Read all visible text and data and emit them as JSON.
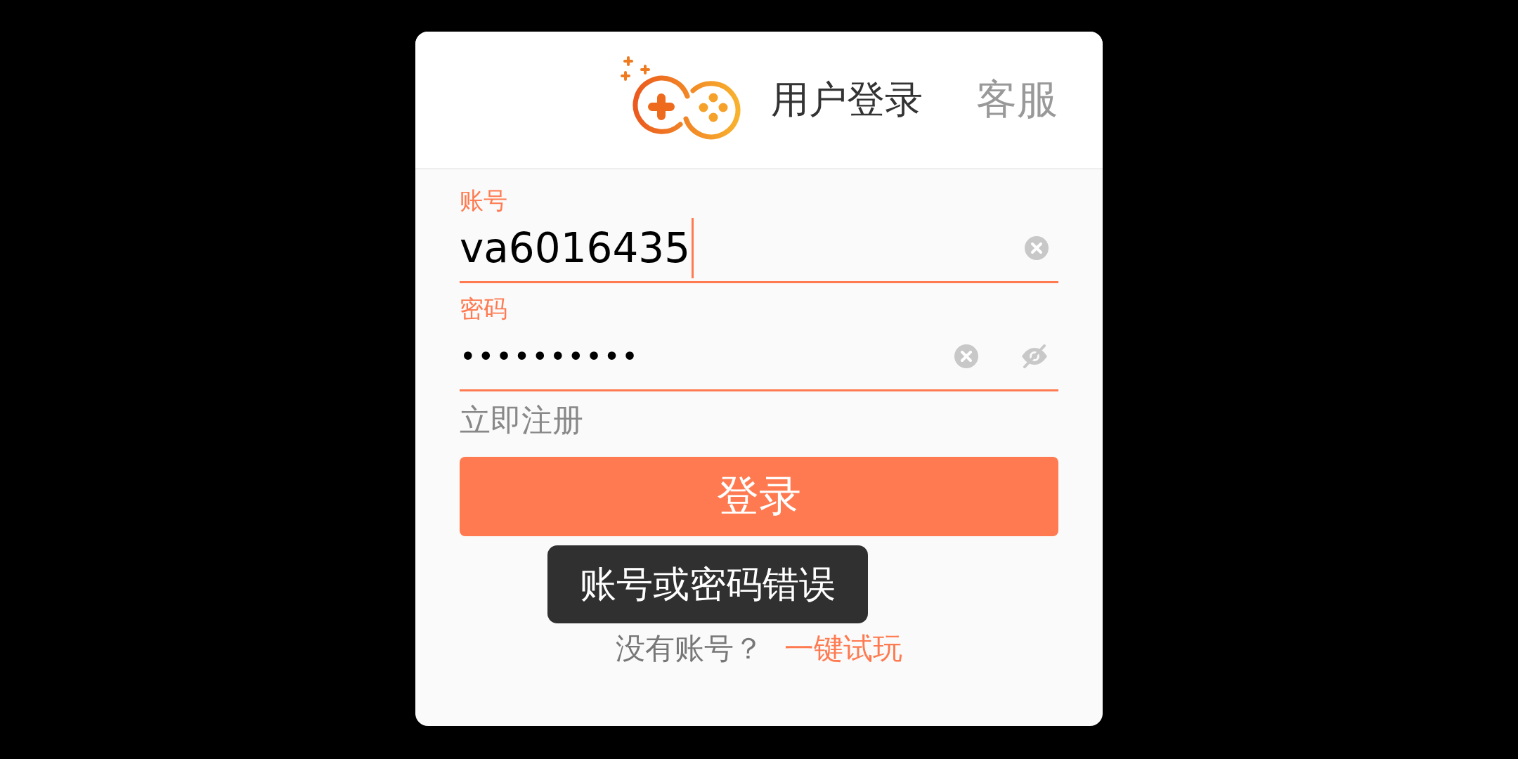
{
  "header": {
    "title": "用户登录",
    "service_link": "客服"
  },
  "account": {
    "label": "账号",
    "value": "va6016435",
    "focused": true
  },
  "password": {
    "label": "密码",
    "value": "••••••••••",
    "masked": true
  },
  "register_link": "立即注册",
  "login_button": "登录",
  "footer": {
    "prompt": "没有账号？",
    "trial_link": "一键试玩"
  },
  "toast": {
    "message": "账号或密码错误"
  }
}
